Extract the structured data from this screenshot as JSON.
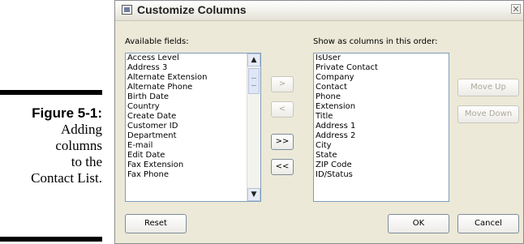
{
  "caption": {
    "label": "Figure 5-1:",
    "lines": [
      "Adding",
      "columns",
      "to the",
      "Contact List."
    ]
  },
  "dialog": {
    "title": "Customize Columns",
    "close_glyph": "✕"
  },
  "available": {
    "label": "Available fields:",
    "items": [
      "Access Level",
      "Address 3",
      "Alternate Extension",
      "Alternate Phone",
      "Birth Date",
      "Country",
      "Create Date",
      "Customer ID",
      "Department",
      "E-mail",
      "Edit Date",
      "Fax Extension",
      "Fax Phone"
    ],
    "scroll_up": "▲",
    "scroll_down": "▼"
  },
  "columns": {
    "label": "Show as columns in this order:",
    "items": [
      "IsUser",
      "Private Contact",
      "Company",
      "Contact",
      "Phone",
      "Extension",
      "Title",
      "Address 1",
      "Address 2",
      "City",
      "State",
      "ZIP Code",
      "ID/Status"
    ]
  },
  "transfer_buttons": {
    "add": ">",
    "remove": "<",
    "add_all": ">>",
    "remove_all": "<<"
  },
  "order_buttons": {
    "move_up": "Move Up",
    "move_down": "Move Down"
  },
  "footer": {
    "reset": "Reset",
    "ok": "OK",
    "cancel": "Cancel"
  }
}
